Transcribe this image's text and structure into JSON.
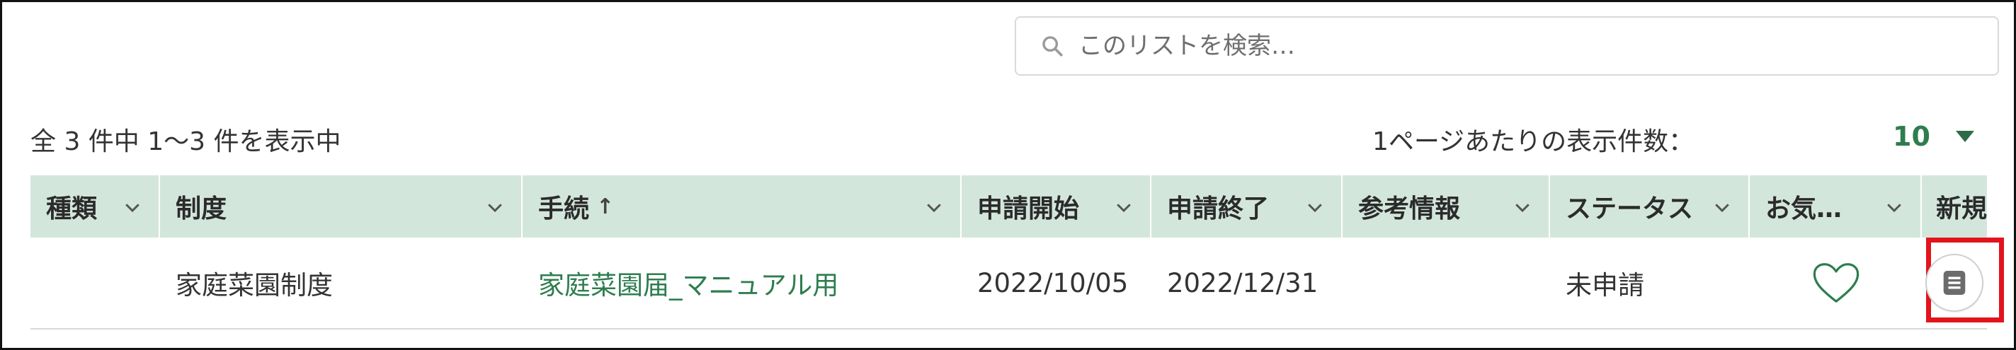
{
  "search": {
    "placeholder": "このリストを検索…"
  },
  "summary": {
    "result_text": "全 3 件中 1～3 件を表示中",
    "per_page_label": "1ページあたりの表示件数：",
    "per_page_value": "10"
  },
  "columns": [
    {
      "label": "種類"
    },
    {
      "label": "制度"
    },
    {
      "label": "手続",
      "sort": "↑"
    },
    {
      "label": "申請開始"
    },
    {
      "label": "申請終了"
    },
    {
      "label": "参考情報"
    },
    {
      "label": "ステータス"
    },
    {
      "label": "お気…"
    },
    {
      "label": "新規"
    }
  ],
  "rows": [
    {
      "type": "",
      "system": "家庭菜園制度",
      "procedure": "家庭菜園届_マニュアル用",
      "start": "2022/10/05",
      "end": "2022/12/31",
      "reference": "",
      "status": "未申請",
      "favorite_icon": "heart-outline-icon",
      "new_icon": "document-list-icon"
    }
  ],
  "colors": {
    "header_bg": "#d3e6dc",
    "link_green": "#2e7d4f",
    "highlight_red": "#e3141c"
  }
}
